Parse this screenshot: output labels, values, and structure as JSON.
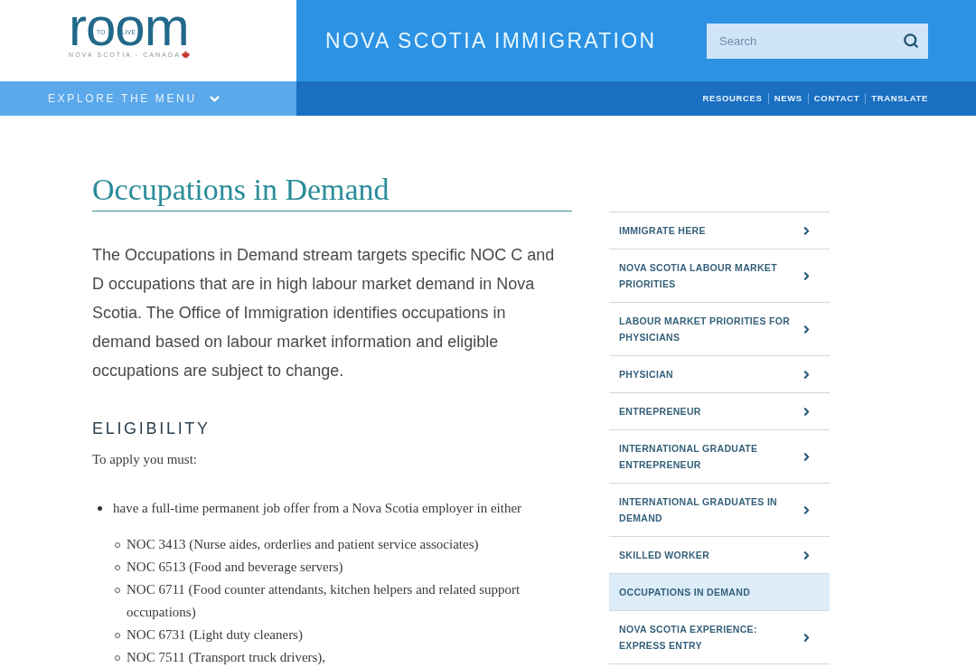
{
  "header": {
    "logo": {
      "wordmark": "room",
      "inner_text": "TO LIVE",
      "tagline": "NOVA SCOTIA - CANADA"
    },
    "site_title": "NOVA SCOTIA IMMIGRATION",
    "search": {
      "placeholder": "Search"
    }
  },
  "nav": {
    "menu_button": "EXPLORE THE MENU",
    "links": [
      "RESOURCES",
      "NEWS",
      "CONTACT",
      "TRANSLATE"
    ]
  },
  "article": {
    "title": "Occupations in Demand",
    "intro": "The Occupations in Demand stream targets specific NOC C and D occupations that are in high labour market demand in Nova Scotia. The Office of Immigration identifies occupations in demand based on labour market information and eligible occupations are subject to change.",
    "sections": [
      {
        "heading": "ELIGIBILITY",
        "lead": "To apply you must:",
        "items": [
          {
            "text": "have a full-time permanent job offer from a Nova Scotia employer in either",
            "children": [
              {
                "text": "NOC 3413 (Nurse aides, orderlies and patient service associates)"
              },
              {
                "text": "NOC 6513 (Food and beverage servers)"
              },
              {
                "text": "NOC 6711 (Food counter attendants, kitchen helpers and related support occupations)"
              },
              {
                "text": "NOC 6731 (Light duty cleaners)"
              },
              {
                "text": "NOC 7511 (Transport truck drivers),"
              }
            ]
          }
        ]
      }
    ]
  },
  "sidebar": {
    "items": [
      {
        "label": "IMMIGRATE HERE",
        "selected": false
      },
      {
        "label": "NOVA SCOTIA LABOUR MARKET PRIORITIES",
        "selected": false
      },
      {
        "label": "LABOUR MARKET PRIORITIES FOR PHYSICIANS",
        "selected": false
      },
      {
        "label": "PHYSICIAN",
        "selected": false
      },
      {
        "label": "ENTREPRENEUR",
        "selected": false
      },
      {
        "label": "INTERNATIONAL GRADUATE ENTREPRENEUR",
        "selected": false
      },
      {
        "label": "INTERNATIONAL GRADUATES IN DEMAND",
        "selected": false
      },
      {
        "label": "SKILLED WORKER",
        "selected": false
      },
      {
        "label": "OCCUPATIONS IN DEMAND",
        "selected": true
      },
      {
        "label": "NOVA SCOTIA EXPERIENCE: EXPRESS ENTRY",
        "selected": false
      }
    ]
  }
}
